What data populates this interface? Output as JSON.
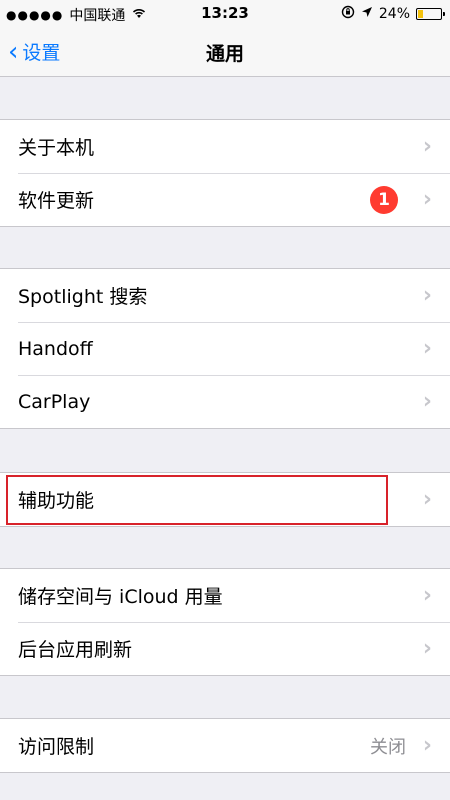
{
  "status_bar": {
    "signal": "●●●●●",
    "carrier": "中国联通",
    "time": "13:23",
    "battery": "24%",
    "battery_level": 0.24
  },
  "nav": {
    "back_label": "设置",
    "title": "通用"
  },
  "groups": [
    {
      "rows": [
        {
          "label": "关于本机"
        },
        {
          "label": "软件更新",
          "badge": "1"
        }
      ]
    },
    {
      "rows": [
        {
          "label": "Spotlight 搜索"
        },
        {
          "label": "Handoff"
        },
        {
          "label": "CarPlay"
        }
      ]
    },
    {
      "rows": [
        {
          "label": "辅助功能"
        }
      ]
    },
    {
      "rows": [
        {
          "label": "储存空间与 iCloud 用量"
        },
        {
          "label": "后台应用刷新"
        }
      ]
    },
    {
      "rows": [
        {
          "label": "访问限制",
          "value": "关闭"
        }
      ]
    }
  ],
  "colors": {
    "accent": "#0a7aff",
    "badge": "#ff3b30",
    "highlight": "#d8222a"
  }
}
